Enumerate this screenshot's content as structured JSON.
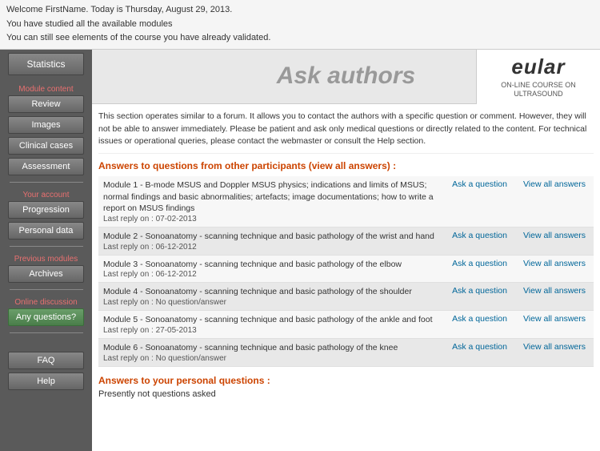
{
  "topInfo": {
    "line1": "Welcome FirstName. Today is Thursday, August 29, 2013.",
    "line2": "You have studied all the available modules",
    "line3": "You can still see elements of the course you have already validated."
  },
  "sidebar": {
    "statistics_label": "Statistics",
    "section1_label": "Module content",
    "btn_review": "Review",
    "btn_images": "Images",
    "btn_clinical": "Clinical cases",
    "btn_assessment": "Assessment",
    "section2_label": "Your account",
    "btn_progression": "Progression",
    "btn_personal": "Personal data",
    "section3_label": "Previous modules",
    "btn_archives": "Archives",
    "section4_label": "Online discussion",
    "btn_any_questions": "Any questions?",
    "btn_faq": "FAQ",
    "btn_help": "Help"
  },
  "header": {
    "title": "Ask authors"
  },
  "eular": {
    "name": "eular",
    "subtitle": "ON-LINE COURSE ON\nULTRASOUND"
  },
  "content": {
    "info": "This section operates similar to a forum. It allows you to contact the authors with a specific question or comment. However, they will not be able to answer immediately. Please be patient and ask only medical questions or directly related to the content. For technical issues or operational queries, please contact the webmaster or consult the Help section.",
    "section_title": "Answers to questions from other participants (view all answers) :",
    "modules": [
      {
        "title": "Module 1 - B-mode MSUS and Doppler MSUS physics; indications and limits of MSUS; normal findings and basic abnormalities; artefacts; image documentations; how to write a report on MSUS findings",
        "date": "Last reply on : 07-02-2013",
        "ask": "Ask a question",
        "view": "View all answers"
      },
      {
        "title": "Module 2 - Sonoanatomy - scanning technique and basic pathology of the wrist and hand",
        "date": "Last reply on : 06-12-2012",
        "ask": "Ask a question",
        "view": "View all answers"
      },
      {
        "title": "Module 3 - Sonoanatomy - scanning technique and basic pathology of the elbow",
        "date": "Last reply on : 06-12-2012",
        "ask": "Ask a question",
        "view": "View all answers"
      },
      {
        "title": "Module 4 - Sonoanatomy - scanning technique and basic pathology of the shoulder",
        "date": "Last reply on : No question/answer",
        "ask": "Ask a question",
        "view": "View all answers"
      },
      {
        "title": "Module 5 - Sonoanatomy - scanning technique and basic pathology of the ankle and foot",
        "date": "Last reply on : 27-05-2013",
        "ask": "Ask a question",
        "view": "View all answers"
      },
      {
        "title": "Module 6 - Sonoanatomy - scanning technique and basic pathology of the knee",
        "date": "Last reply on : No question/answer",
        "ask": "Ask a question",
        "view": "View all answers"
      }
    ],
    "personal_section_title": "Answers to your personal questions :",
    "no_questions": "Presently not questions asked"
  }
}
